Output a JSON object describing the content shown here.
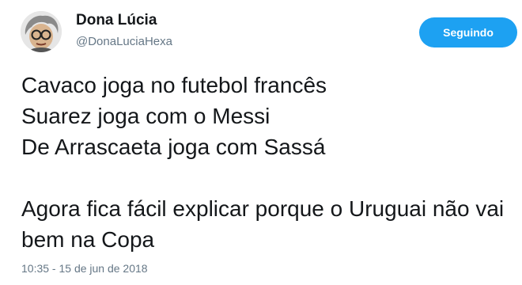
{
  "author": {
    "display_name": "Dona Lúcia",
    "handle": "@DonaLuciaHexa"
  },
  "follow_button": {
    "label": "Seguindo",
    "color": "#1da1f2"
  },
  "tweet": {
    "lines": [
      "Cavaco joga no futebol francês",
      "Suarez joga com o Messi",
      "De Arrascaeta joga com Sassá",
      "Agora fica fácil explicar porque o Uruguai não vai bem na Copa"
    ],
    "timestamp": "10:35 - 15 de jun de 2018"
  }
}
